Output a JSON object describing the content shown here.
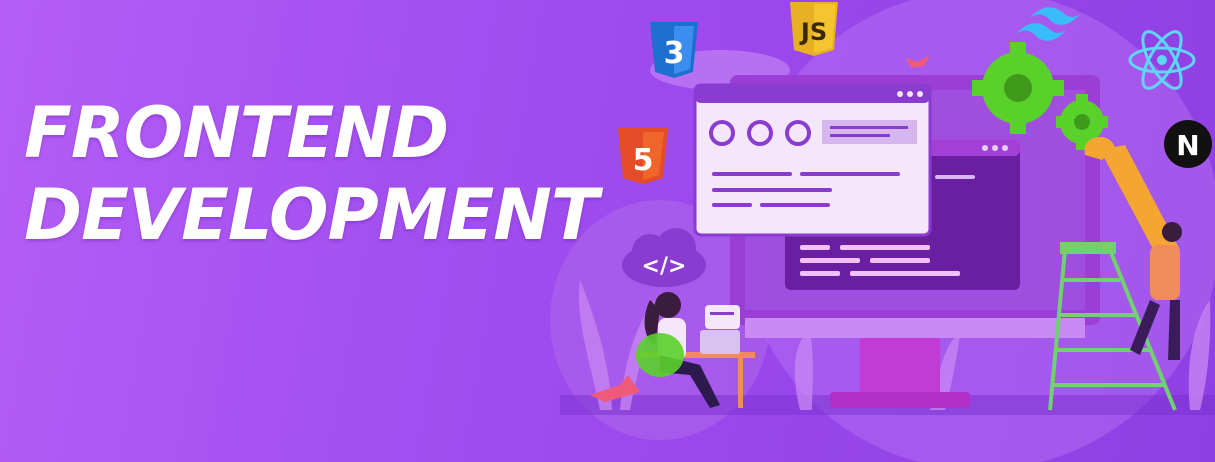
{
  "headline": {
    "line1": "FRONTEND",
    "line2": "DEVELOPMENT"
  },
  "code_cloud_label": "</>",
  "logos": {
    "css3": "3",
    "js": "JS",
    "html5": "5",
    "next": "N"
  },
  "colors": {
    "background": "#a34ff0",
    "headline": "#ffffff",
    "gear": "#5ad12b",
    "wrench": "#f3a632",
    "monitor": "#c23bd4"
  },
  "icons": [
    "css3-icon",
    "js-icon",
    "html5-icon",
    "tailwind-icon",
    "react-icon",
    "nextjs-icon",
    "gear-icon",
    "wrench-icon",
    "code-cloud-icon"
  ]
}
